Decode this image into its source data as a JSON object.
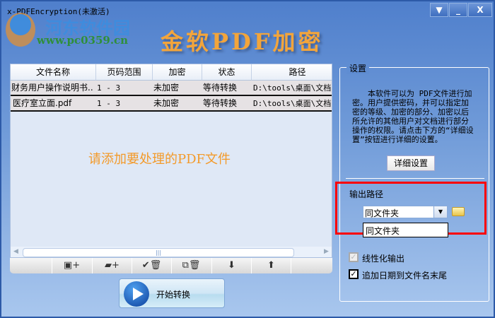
{
  "window": {
    "title": "x-PDFEncryption(未激活)",
    "menu_icon": "▼",
    "minimize": "_",
    "close": "X"
  },
  "watermark": {
    "name": "河东软件园",
    "url": "www.pc0359.cn"
  },
  "app_title": "金软PDF加密",
  "table": {
    "columns": [
      "文件名称",
      "页码范围",
      "加密",
      "状态",
      "路径"
    ],
    "rows": [
      [
        "财务用户操作说明书..",
        "1 - 3",
        "未加密",
        "等待转换",
        "D:\\tools\\桌面\\文档\\"
      ],
      [
        "医疗室立面.pdf",
        "1 - 3",
        "未加密",
        "等待转换",
        "D:\\tools\\桌面\\文档\\"
      ]
    ],
    "hint": "请添加要处理的PDF文件"
  },
  "toolbar": {
    "add_file": "add-file",
    "add_folder": "add-folder",
    "remove_checked": "remove-checked",
    "remove_all": "remove-all",
    "move_down": "move-down",
    "move_up": "move-up"
  },
  "start_button": "开始转换",
  "settings": {
    "title": "设置",
    "description": "本软件可以为 PDF文件进行加密。用户提供密码，并可以指定加密的等级、加密的部分、加密以后所允许的其他用户对文档进行部分操作的权限。请点击下方的“详细设置”按钮进行详细的设置。",
    "detail_button": "详细设置",
    "output_label": "输出路径",
    "output_value": "同文件夹",
    "dropdown_options": [
      "同文件夹"
    ],
    "linearize": {
      "label": "线性化输出",
      "checked": true,
      "disabled": true
    },
    "append_date": {
      "label": "追加日期到文件名末尾",
      "checked": true
    }
  }
}
